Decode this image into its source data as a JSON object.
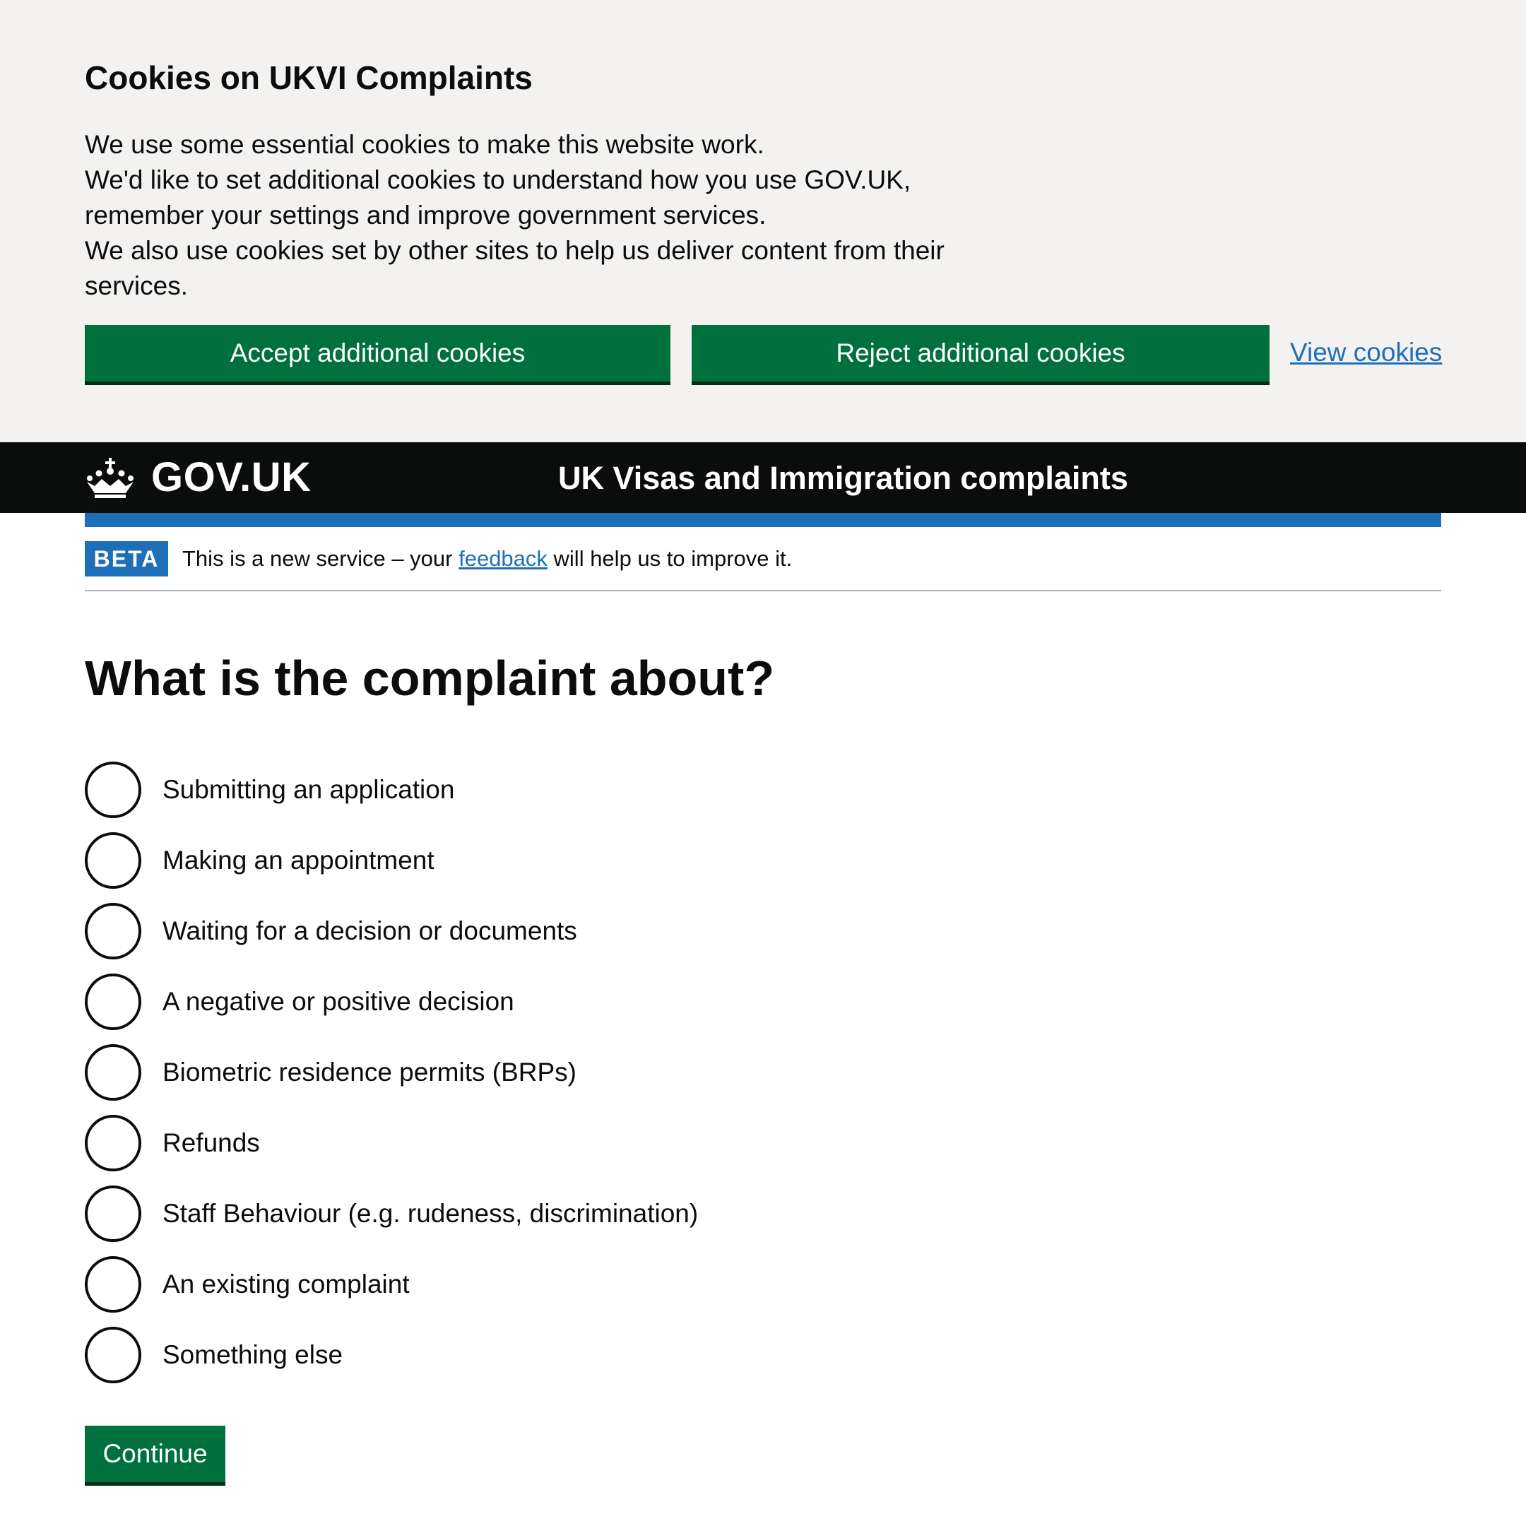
{
  "cookie_banner": {
    "heading": "Cookies on UKVI Complaints",
    "p1": "We use some essential cookies to make this website work.",
    "p2": "We'd like to set additional cookies to understand how you use GOV.UK, remember your settings and improve government services.",
    "p3": "We also use cookies set by other sites to help us deliver content from their services.",
    "accept_label": "Accept additional cookies",
    "reject_label": "Reject additional cookies",
    "view_label": "View cookies"
  },
  "header": {
    "logotype": "GOV.UK",
    "service_name": "UK Visas and Immigration complaints",
    "logo_icon": "crown-icon"
  },
  "phase_banner": {
    "tag": "BETA",
    "text_before": "This is a new service – your ",
    "link": "feedback",
    "text_after": " will help us to improve it."
  },
  "main": {
    "title": "What is the complaint about?",
    "options": [
      "Submitting an application",
      "Making an appointment",
      "Waiting for a decision or documents",
      "A negative or positive decision",
      "Biometric residence permits (BRPs)",
      "Refunds",
      "Staff Behaviour (e.g. rudeness, discrimination)",
      "An existing complaint",
      "Something else"
    ],
    "continue_label": "Continue"
  },
  "colors": {
    "button_green": "#00703c",
    "header_black": "#0b0c0c",
    "link_blue": "#1d70b8",
    "banner_grey": "#f3f2f1"
  }
}
